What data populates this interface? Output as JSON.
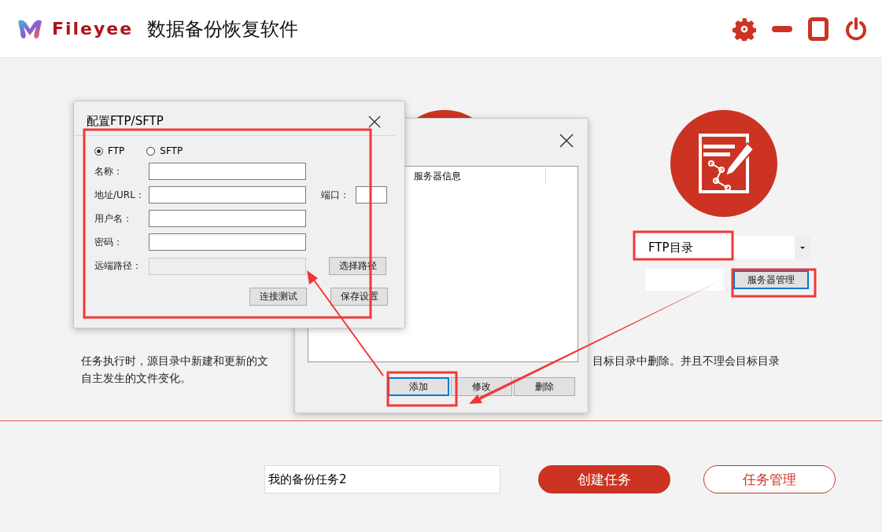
{
  "app": {
    "brand": "Fileyee",
    "title": "数据备份恢复软件"
  },
  "target": {
    "type_select": {
      "value": "FTP目录"
    },
    "server_button": "服务器管理"
  },
  "description": {
    "line_1_left": "任务执行时，源目录中新建和更新的文",
    "line_1_right": "目标目录中删除。并且不理会目标目录",
    "line_2": "自主发生的文件变化。"
  },
  "task_name": {
    "value": "我的备份任务2"
  },
  "actions": [
    {
      "label": "创建任务",
      "kind": "primary"
    },
    {
      "label": "任务管理",
      "kind": "outline"
    }
  ],
  "server_dialog": {
    "list_header": "服务器信息",
    "buttons": [
      {
        "label": "添加",
        "focused": true
      },
      {
        "label": "修改",
        "focused": false
      },
      {
        "label": "删除",
        "focused": false
      }
    ]
  },
  "ftp_dialog": {
    "title": "配置FTP/SFTP",
    "protocols": [
      {
        "label": "FTP",
        "selected": true
      },
      {
        "label": "SFTP",
        "selected": false
      }
    ],
    "fields": [
      {
        "label": "名称：",
        "disabled": false
      },
      {
        "label": "地址/URL：",
        "disabled": false,
        "port_label": "端口："
      },
      {
        "label": "用户名：",
        "disabled": false
      },
      {
        "label": "密码：",
        "disabled": false
      },
      {
        "label": "远端路径：",
        "disabled": true,
        "button": "选择路径"
      }
    ],
    "buttons": [
      "连接测试",
      "保存设置"
    ]
  }
}
